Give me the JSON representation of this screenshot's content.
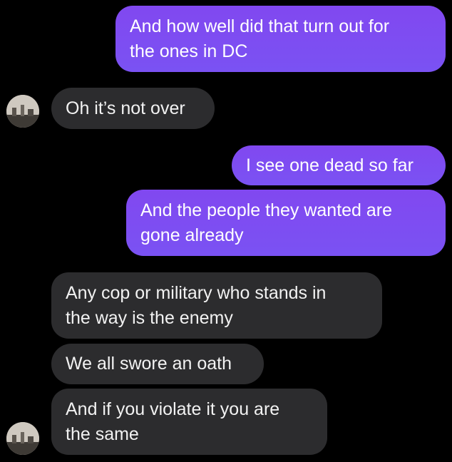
{
  "conversation": {
    "messages": [
      {
        "side": "sent",
        "text": "And how well did that turn out for\nthe ones in DC"
      },
      {
        "side": "received",
        "text": "Oh it’s not over"
      },
      {
        "side": "sent",
        "text": "I see one dead so far"
      },
      {
        "side": "sent",
        "text": "And the people they wanted are\ngone already"
      },
      {
        "side": "received",
        "text": "Any cop or military who stands in\nthe way is the enemy"
      },
      {
        "side": "received",
        "text": "We all swore an oath"
      },
      {
        "side": "received",
        "text": "And if you violate it you are\nthe same"
      }
    ]
  },
  "colors": {
    "background": "#000000",
    "sent_bubble": "#7e4cf2",
    "received_bubble": "#2c2c2e",
    "text": "#ffffff"
  },
  "icons": {
    "avatar": "contact-avatar-photo"
  }
}
